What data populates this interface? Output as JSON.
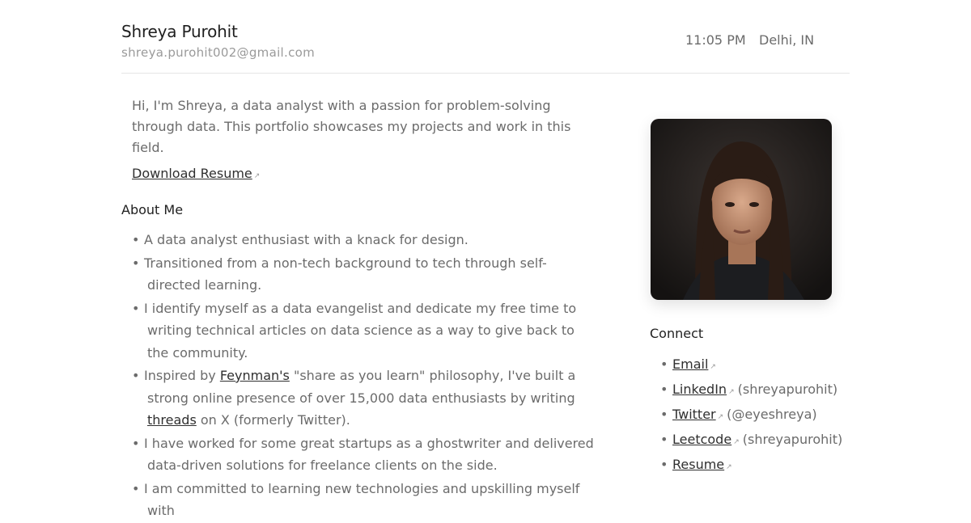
{
  "header": {
    "name": "Shreya Purohit",
    "email": "shreya.purohit002@gmail.com",
    "time": "11:05 PM",
    "location": "Delhi, IN"
  },
  "intro": {
    "text": "Hi, I'm Shreya, a data analyst with a passion for problem-solving through data. This portfolio showcases my projects and work in this field.",
    "download_label": "Download Resume"
  },
  "about": {
    "title": "About Me",
    "items": [
      "A data analyst enthusiast with a knack for design.",
      "Transitioned from a non-tech background to tech through self-directed learning.",
      "I identify myself as a data evangelist and dedicate my free time to writing technical articles on data science as a way to give back to the community.",
      {
        "prefix": "Inspired by ",
        "link1": "Feynman's",
        "middle": " \"share as you learn\" philosophy, I've built a strong online presence of over 15,000 data enthusiasts by writing ",
        "link2": "threads",
        "suffix": " on X (formerly Twitter)."
      },
      "I have worked for some great startups as a ghostwriter and delivered data-driven solutions for freelance clients on the side.",
      "I am committed to learning new technologies and upskilling myself with"
    ]
  },
  "photo": {
    "alt": "Profile photo"
  },
  "connect": {
    "title": "Connect",
    "items": [
      {
        "label": "Email",
        "handle": ""
      },
      {
        "label": "LinkedIn",
        "handle": "(shreyapurohit)"
      },
      {
        "label": "Twitter",
        "handle": "(@eyeshreya)"
      },
      {
        "label": "Leetcode",
        "handle": "(shreyapurohit)"
      },
      {
        "label": "Resume",
        "handle": ""
      }
    ]
  },
  "icons": {
    "external_link": "external-link-icon",
    "bullet": "bullet-dot"
  },
  "colors": {
    "text": "#6b6b6b",
    "heading": "#1f1f1f",
    "link": "#2f2f2f",
    "muted": "#9a9a9a",
    "divider": "#e5e5e5"
  }
}
